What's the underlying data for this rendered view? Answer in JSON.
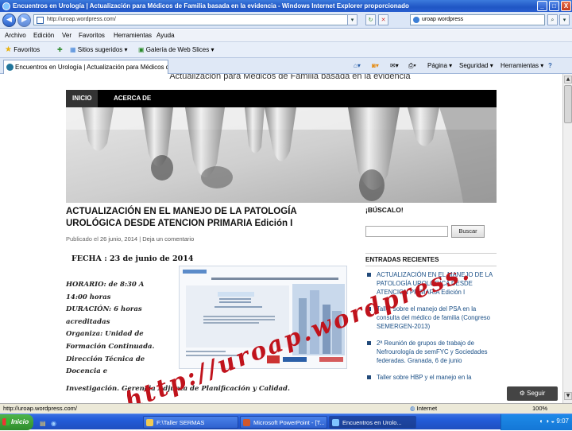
{
  "window": {
    "title": "Encuentros en Urología | Actualización para Médicos de Familia basada en la evidencia - Windows Internet Explorer proporcionado",
    "minimize": "_",
    "maximize": "□",
    "close": "X"
  },
  "address_bar": {
    "url": "http://uroap.wordpress.com/",
    "search_value": "uroap wordpress"
  },
  "menu": [
    "Archivo",
    "Edición",
    "Ver",
    "Favoritos",
    "Herramientas",
    "Ayuda"
  ],
  "favorites_bar": {
    "favorites_label": "Favoritos",
    "suggested_sites": "Sitios sugeridos ▾",
    "web_slices": "Galería de Web Slices ▾"
  },
  "tab": {
    "label": "Encuentros en Urología | Actualización para Médicos d"
  },
  "command_bar": {
    "page": "Página ▾",
    "safety": "Seguridad ▾",
    "tools": "Herramientas ▾",
    "help": "?"
  },
  "site": {
    "tagline": "Actualización para Médicos de Familia basada en la evidencia",
    "nav": [
      "INICIO",
      "ACERCA DE"
    ],
    "post": {
      "title_line1": "ACTUALIZACIÓN EN EL MANEJO DE LA PATOLOGÍA",
      "title_line2": "UROLÓGICA DESDE ATENCION PRIMARIA Edición I",
      "meta_prefix": "Publicado el",
      "meta_date": "26 junio, 2014",
      "meta_sep": "|",
      "meta_comment": "Deja un comentario",
      "date_line": "FECHA : 23 de junio de 2014",
      "body_lines": [
        "HORARIO: de 8:30 A",
        "14:00 horas",
        "DURACIÓN: 6 horas",
        "acreditadas",
        "Organiza: Unidad de",
        "Formación Continuada.",
        "Dirección Técnica de",
        "Docencia e"
      ],
      "footer_line": "Investigación. Gerencia Adjunta de Planificación y Calidad."
    },
    "sidebar": {
      "search_heading": "¡BÚSCALO!",
      "search_button": "Buscar",
      "recent_heading": "ENTRADAS RECIENTES",
      "recent": [
        "ACTUALIZACIÓN EN EL MANEJO DE LA PATOLOGÍA UROLÓGICA DESDE ATENCION PRIMARIA Edición I",
        "Taller sobre el manejo del PSA en la consulta del médico de familia (Congreso SEMERGEN-2013)",
        "2ª Reunión de grupos de trabajo de Nefrourología de semFYC y Sociedades federadas. Granada, 6 de junio",
        "Taller sobre HBP y el manejo en la"
      ]
    },
    "follow_button": "Seguir",
    "watermark": "http://uroap.wordpress.com"
  },
  "status_bar": {
    "url": "http://uroap.wordpress.com/",
    "zone": "Internet",
    "zoom": "100%"
  },
  "taskbar": {
    "start": "Inicio",
    "items": [
      "F:\\Taller SERMAS",
      "Microsoft PowerPoint - [T...",
      "Encuentros en Urolo..."
    ],
    "clock": "9:07"
  },
  "colors": {
    "titlebar": "#1f56c4",
    "nav_bg": "#000000",
    "sidebar_link": "#1a4f86",
    "watermark": "#c0131c",
    "taskbar": "#245edb"
  }
}
